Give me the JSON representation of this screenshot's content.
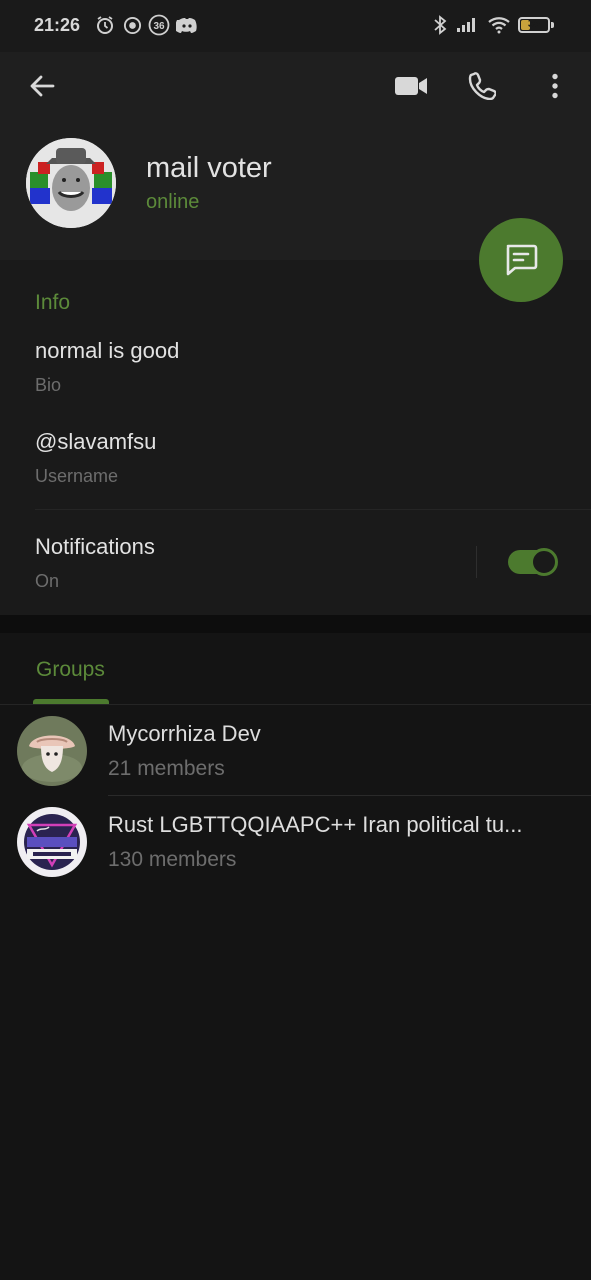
{
  "status_bar": {
    "time": "21:26",
    "notification_icons": [
      "alarm-icon",
      "podcast-icon",
      "badge-36-icon",
      "discord-icon"
    ],
    "notification_badge": "36",
    "right_icons": [
      "bluetooth-icon",
      "signal-icon",
      "wifi-icon",
      "battery-icon"
    ],
    "battery_level": "36",
    "battery_fraction": 0.36
  },
  "toolbar": {
    "back_icon": "arrow-left-icon",
    "video_icon": "video-camera-icon",
    "call_icon": "phone-icon",
    "more_icon": "more-vertical-icon"
  },
  "profile": {
    "name": "mail voter",
    "status": "online",
    "fab_icon": "message-icon"
  },
  "info": {
    "title": "Info",
    "bio": "normal is good",
    "bio_label": "Bio",
    "username": "@slavamfsu",
    "username_label": "Username",
    "notifications": "Notifications",
    "notifications_state": "On",
    "notifications_enabled": true
  },
  "tabs": {
    "groups": "Groups"
  },
  "groups": [
    {
      "name": "Mycorrhiza Dev",
      "members": "21 members"
    },
    {
      "name": "Rust LGBTTQQIAAPC++ Iran political tu...",
      "members": "130 members"
    }
  ],
  "colors": {
    "accent": "#5c8a3a",
    "accent_dark": "#4c7a2e",
    "background": "#141414",
    "header": "#1f1f1f"
  }
}
